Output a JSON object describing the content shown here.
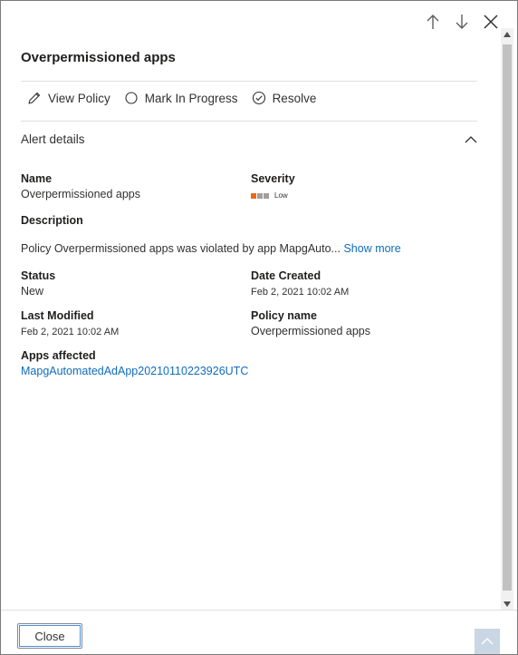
{
  "panel": {
    "title": "Overpermissioned apps"
  },
  "actions": [
    {
      "label": "View Policy",
      "icon": "pencil-icon"
    },
    {
      "label": "Mark In Progress",
      "icon": "circle-icon"
    },
    {
      "label": "Resolve",
      "icon": "check-circle-icon"
    }
  ],
  "section": {
    "title": "Alert details",
    "expanded": true
  },
  "details": {
    "name_label": "Name",
    "name_value": "Overpermissioned apps",
    "severity_label": "Severity",
    "severity_value": "Low",
    "severity_level": 1,
    "severity_levels_total": 3,
    "severity_colors": [
      "#ea6a12",
      "#a19f9d",
      "#a19f9d"
    ],
    "description_label": "Description",
    "description_value": "Policy Overpermissioned apps was violated by app MapgAuto...",
    "show_more": "Show more",
    "status_label": "Status",
    "status_value": "New",
    "date_created_label": "Date Created",
    "date_created_value": "Feb 2, 2021 10:02 AM",
    "last_modified_label": "Last Modified",
    "last_modified_value": "Feb 2, 2021 10:02 AM",
    "policy_name_label": "Policy name",
    "policy_name_value": "Overpermissioned apps",
    "apps_affected_label": "Apps affected",
    "apps_affected_value": "MapgAutomatedAdApp20210110223926UTC"
  },
  "footer": {
    "close_label": "Close"
  },
  "colors": {
    "accent_link": "#0f6cbd",
    "severity_low": "#ea6a12",
    "severity_inactive": "#a19f9d"
  }
}
